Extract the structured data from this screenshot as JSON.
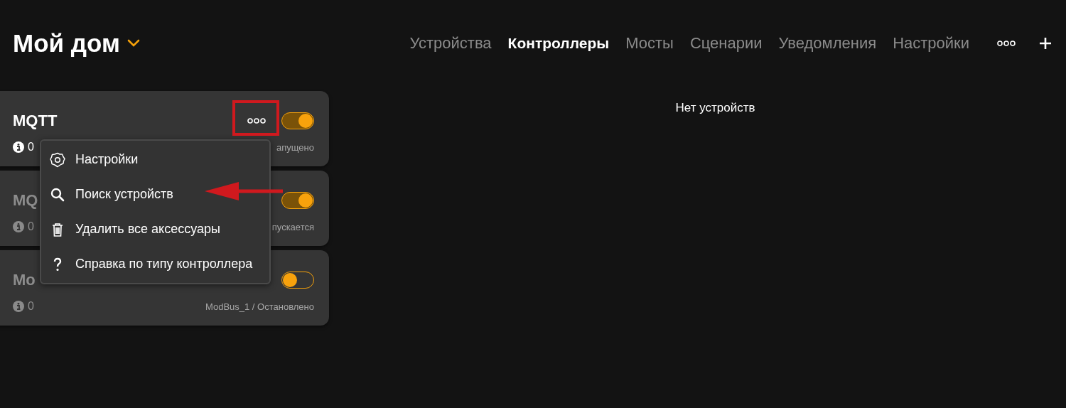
{
  "header": {
    "title": "Мой дом"
  },
  "tabs": [
    {
      "label": "Устройства",
      "selected": false
    },
    {
      "label": "Контроллеры",
      "selected": true
    },
    {
      "label": "Мосты",
      "selected": false
    },
    {
      "label": "Сценарии",
      "selected": false
    },
    {
      "label": "Уведомления",
      "selected": false
    },
    {
      "label": "Настройки",
      "selected": false
    }
  ],
  "controllers": [
    {
      "name": "MQTT",
      "count": "0",
      "status": "апущено",
      "running": true,
      "on": true
    },
    {
      "name": "MQ",
      "count": "0",
      "status": "пускается",
      "running": false,
      "on": true
    },
    {
      "name": "Mo",
      "count": "0",
      "status": "ModBus_1 / Остановлено",
      "running": false,
      "on": false
    }
  ],
  "empty_message": "Нет устройств",
  "menu": {
    "items": [
      {
        "kind": "settings",
        "label": "Настройки"
      },
      {
        "kind": "search",
        "label": "Поиск устройств"
      },
      {
        "kind": "delete",
        "label": "Удалить все аксессуары"
      },
      {
        "kind": "help",
        "label": "Справка по типу контроллера"
      }
    ]
  }
}
